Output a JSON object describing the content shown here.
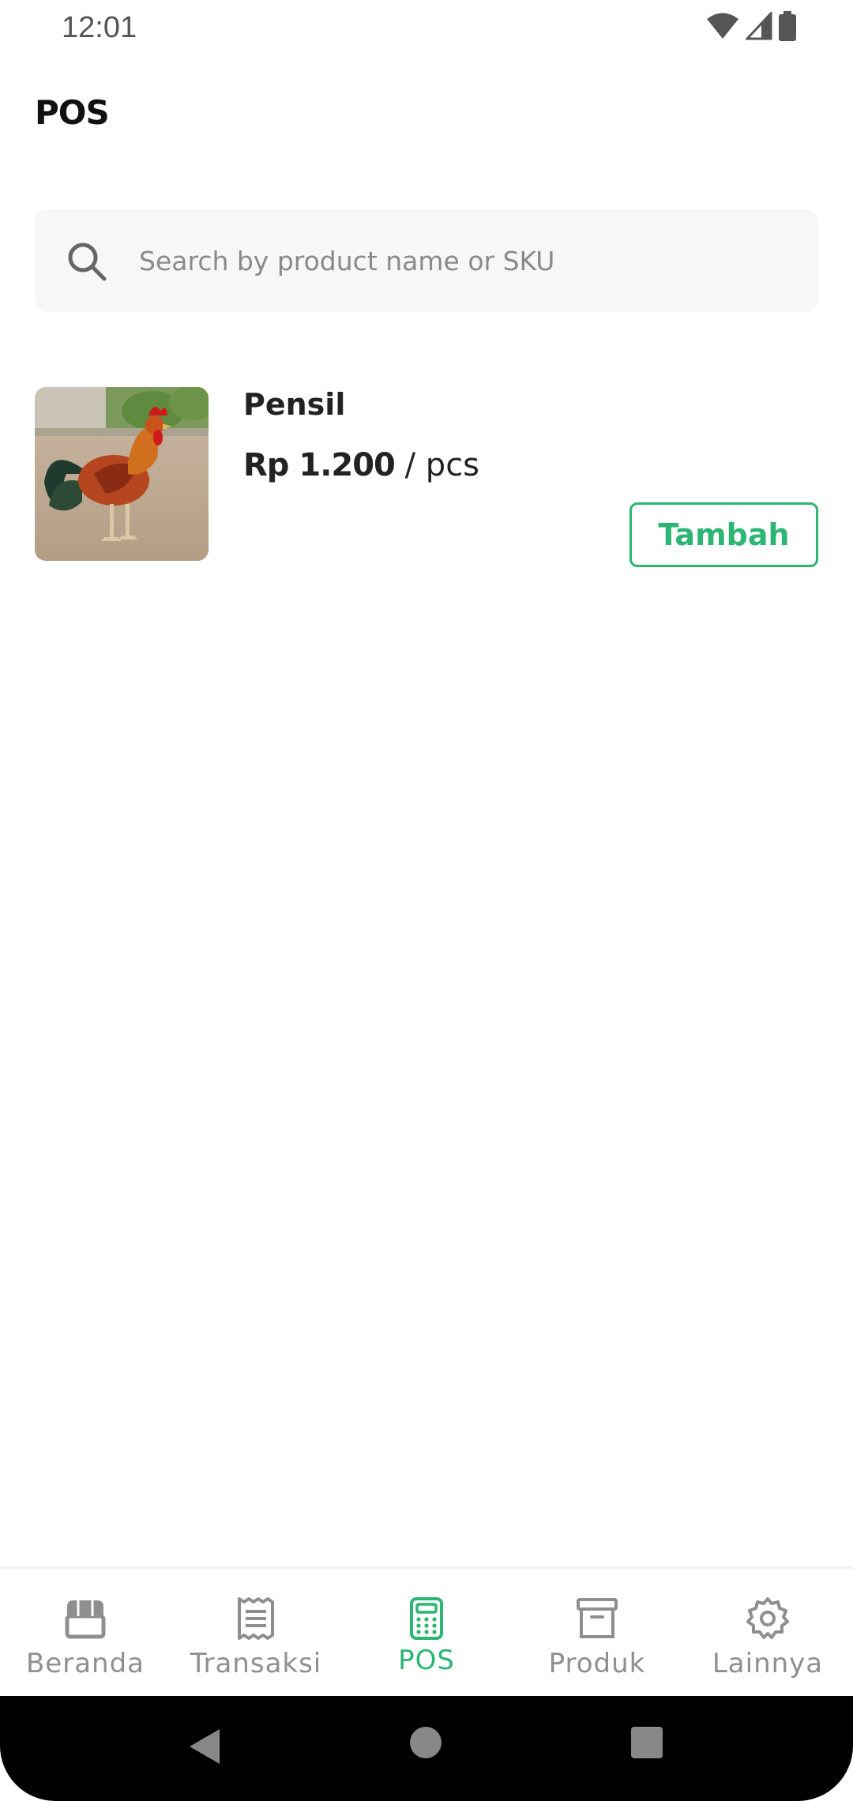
{
  "status_bar": {
    "time": "12:01"
  },
  "header": {
    "title": "POS"
  },
  "search": {
    "placeholder": "Search by product name or SKU",
    "value": ""
  },
  "products": [
    {
      "name": "Pensil",
      "price": "Rp 1.200",
      "unit": " / pcs",
      "add_label": "Tambah",
      "image": "rooster-photo"
    }
  ],
  "bottom_nav": {
    "active": "POS",
    "items": [
      {
        "label": "Beranda",
        "icon": "store-icon"
      },
      {
        "label": "Transaksi",
        "icon": "receipt-icon"
      },
      {
        "label": "POS",
        "icon": "calculator-icon"
      },
      {
        "label": "Produk",
        "icon": "archive-box-icon"
      },
      {
        "label": "Lainnya",
        "icon": "gear-icon"
      }
    ]
  },
  "colors": {
    "accent": "#2bb673",
    "inactive": "#8f8f8f",
    "text": "#222222",
    "search_bg": "#f7f7f7"
  }
}
